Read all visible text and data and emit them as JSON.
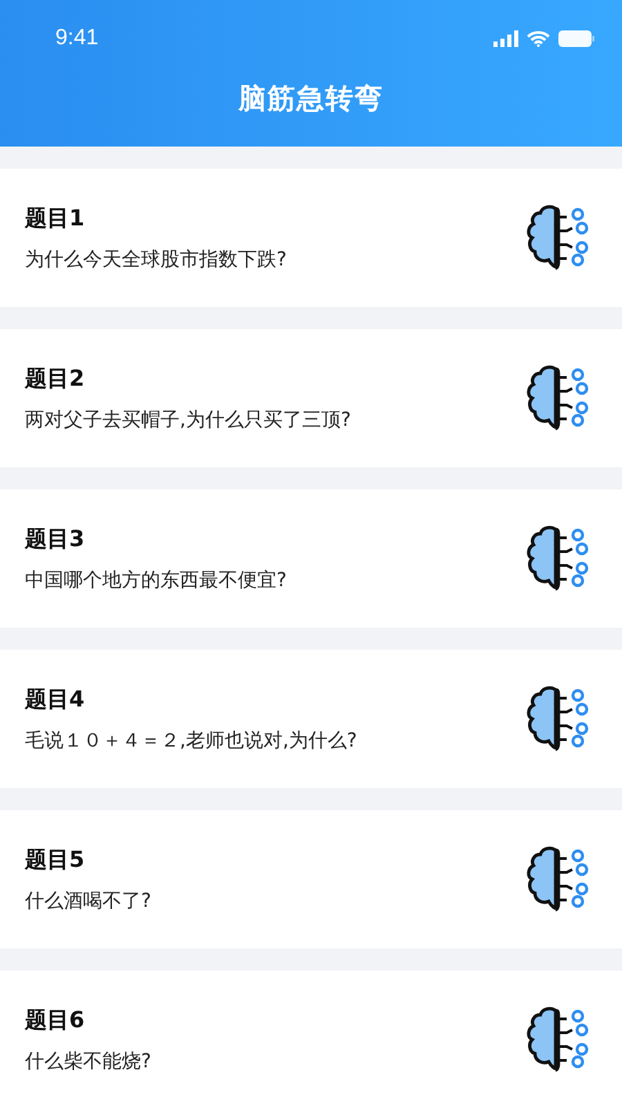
{
  "status_bar": {
    "time": "9:41"
  },
  "header": {
    "title": "脑筋急转弯"
  },
  "questions": [
    {
      "title": "题目1",
      "text": "为什么今天全球股市指数下跌?"
    },
    {
      "title": "题目2",
      "text": "两对父子去买帽子,为什么只买了三顶?"
    },
    {
      "title": "题目3",
      "text": "中国哪个地方的东西最不便宜?"
    },
    {
      "title": "题目4",
      "text": "毛说１０＋４＝２,老师也说对,为什么?"
    },
    {
      "title": "题目5",
      "text": "什么酒喝不了?"
    },
    {
      "title": "题目6",
      "text": "什么柴不能烧?"
    }
  ]
}
